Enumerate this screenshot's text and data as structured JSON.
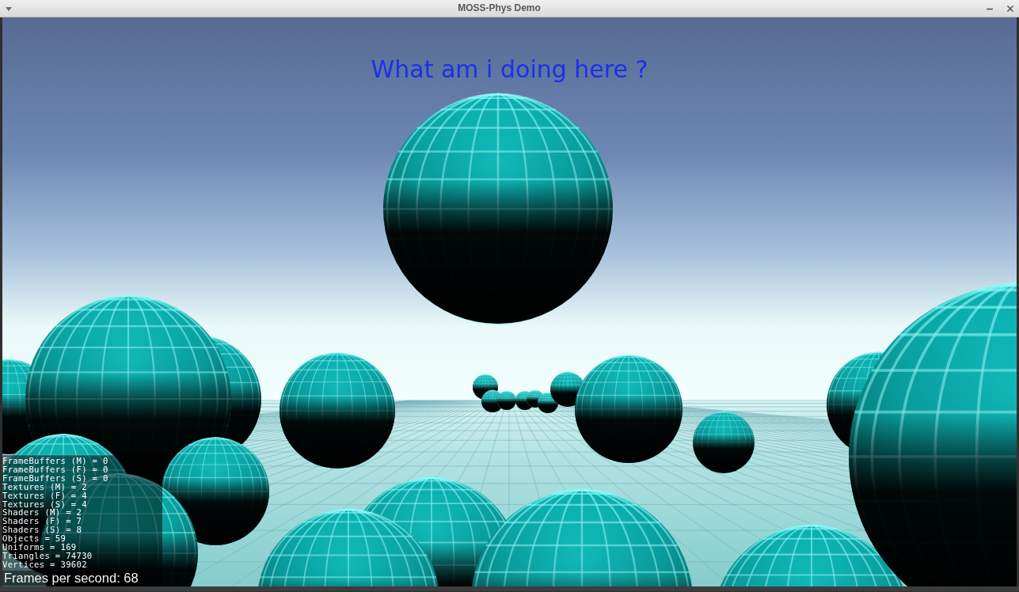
{
  "window": {
    "title": "MOSS-Phys Demo"
  },
  "scene": {
    "caption": "What am i doing here ?"
  },
  "stats": {
    "lines": [
      "FrameBuffers (M) = 0",
      "FrameBuffers (F) = 0",
      "FrameBuffers (S) = 0",
      "Textures (M) = 2",
      "Textures (F) = 4",
      "Textures (S) = 4",
      "Shaders (M) = 2",
      "Shaders (F) = 7",
      "Shaders (S) = 8",
      "Objects = 59",
      "Uniforms = 169",
      "Triangles = 74730",
      "Vertices = 39602"
    ],
    "fps": "Frames per second: 68"
  }
}
